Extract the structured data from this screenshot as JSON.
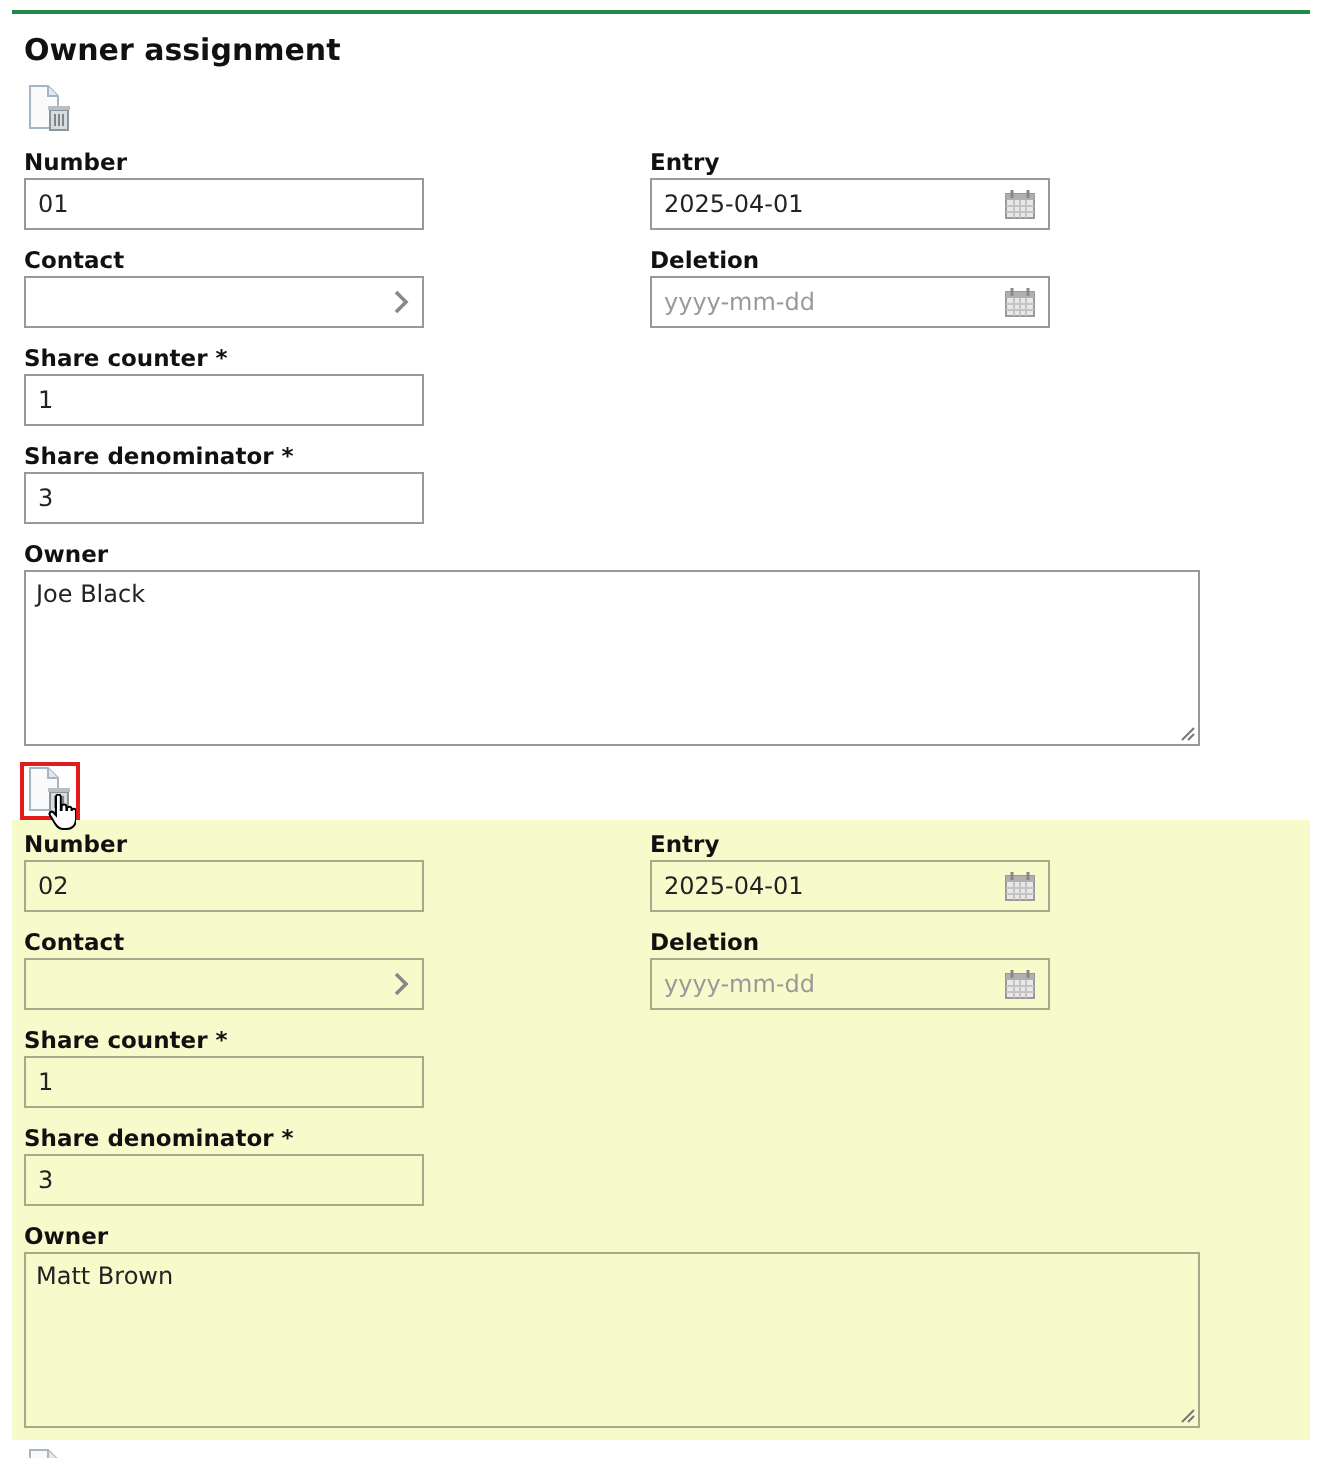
{
  "title": "Owner assignment",
  "records": [
    {
      "highlighted": false,
      "delete_focused": false,
      "hovered": false,
      "left": [
        {
          "label": "Number",
          "kind": "text",
          "value": "01"
        },
        {
          "label": "Contact",
          "kind": "picker"
        },
        {
          "label": "Share counter *",
          "kind": "text",
          "value": "1"
        },
        {
          "label": "Share denominator *",
          "kind": "text",
          "value": "3"
        }
      ],
      "right": [
        {
          "label": "Entry",
          "kind": "date",
          "value": "2025-04-01"
        },
        {
          "label": "Deletion",
          "kind": "date",
          "placeholder": "yyyy-mm-dd"
        }
      ],
      "owner": {
        "label": "Owner",
        "value": "Joe Black"
      }
    },
    {
      "highlighted": true,
      "delete_focused": true,
      "hovered": true,
      "left": [
        {
          "label": "Number",
          "kind": "text",
          "value": "02"
        },
        {
          "label": "Contact",
          "kind": "picker"
        },
        {
          "label": "Share counter *",
          "kind": "text",
          "value": "1"
        },
        {
          "label": "Share denominator *",
          "kind": "text",
          "value": "3"
        }
      ],
      "right": [
        {
          "label": "Entry",
          "kind": "date",
          "value": "2025-04-01"
        },
        {
          "label": "Deletion",
          "kind": "date",
          "placeholder": "yyyy-mm-dd"
        }
      ],
      "owner": {
        "label": "Owner",
        "value": "Matt Brown"
      }
    }
  ]
}
